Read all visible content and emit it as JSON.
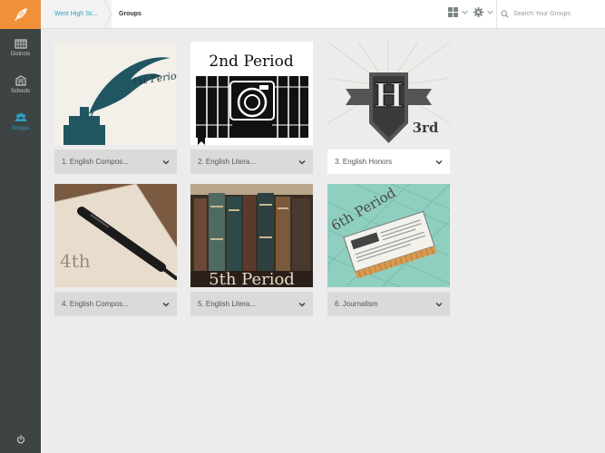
{
  "sidebar": {
    "items": [
      {
        "label": "Districts",
        "icon": "building-grid-icon"
      },
      {
        "label": "Schools",
        "icon": "school-icon"
      },
      {
        "label": "Groups",
        "icon": "people-icon"
      }
    ]
  },
  "breadcrumb": {
    "school": "West High Sc...",
    "current": "Groups"
  },
  "search": {
    "placeholder": "Search Your Groups"
  },
  "colors": {
    "accent": "#2a9fc9",
    "logo_bg": "#f0913a",
    "sidebar_bg": "#3e4444"
  },
  "groups": [
    {
      "label": "1. English Compos...",
      "art_text": "1st Period"
    },
    {
      "label": "2. English Litera...",
      "art_text": "2nd Period"
    },
    {
      "label": "3. English Honors",
      "art_text": "3rd",
      "art_letter": "H"
    },
    {
      "label": "4. English Compos...",
      "art_text": "4th"
    },
    {
      "label": "5. English Litera...",
      "art_text": "5th Period"
    },
    {
      "label": "6. Journalism",
      "art_text": "6th Period"
    }
  ]
}
